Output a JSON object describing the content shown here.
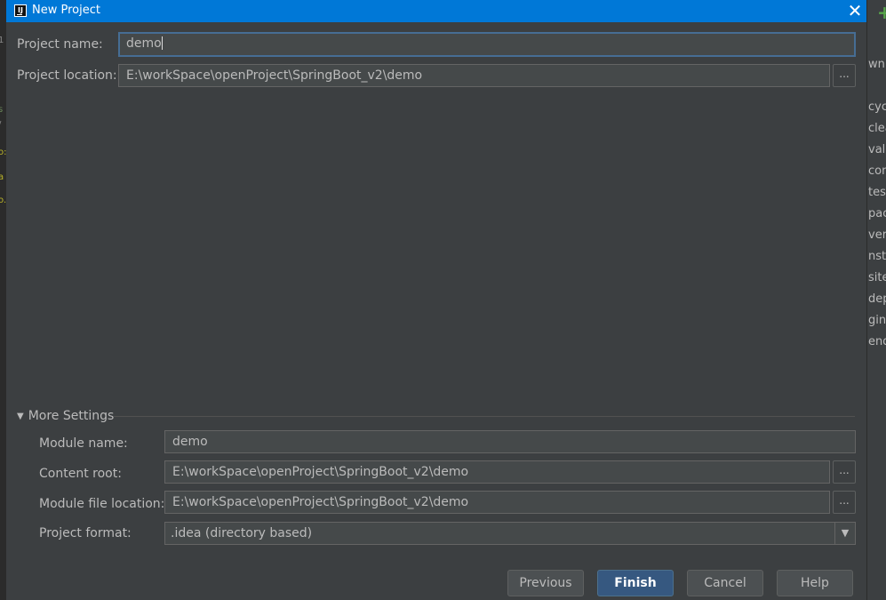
{
  "window": {
    "title": "New Project",
    "close_glyph": "✕",
    "app_icon": "intellij-icon"
  },
  "background": {
    "left_fragments": [
      "1",
      "t",
      "s",
      "/",
      "o:",
      "a",
      "o."
    ],
    "right_fragments": [
      "wnlo",
      "cycl",
      "clea",
      "vali",
      "com",
      "test",
      "pac",
      "veri",
      "nst",
      "site",
      "dep",
      "gins",
      "end"
    ]
  },
  "project": {
    "name_label": "Project name:",
    "name_value": "demo",
    "location_label": "Project location:",
    "location_value": "E:\\workSpace\\openProject\\SpringBoot_v2\\demo"
  },
  "more_settings": {
    "title": "More Settings",
    "module_name_label": "Module name:",
    "module_name_value": "demo",
    "content_root_label": "Content root:",
    "content_root_value": "E:\\workSpace\\openProject\\SpringBoot_v2\\demo",
    "module_file_label": "Module file location:",
    "module_file_value": "E:\\workSpace\\openProject\\SpringBoot_v2\\demo",
    "format_label": "Project format:",
    "format_value": ".idea (directory based)"
  },
  "buttons": {
    "previous": "Previous",
    "finish": "Finish",
    "cancel": "Cancel",
    "help": "Help",
    "browse": "..."
  },
  "colors": {
    "titlebar": "#0078d7",
    "dialog_bg": "#3c3f41",
    "field_bg": "#45494a",
    "focus_border": "#466d94",
    "primary_button": "#365880"
  }
}
